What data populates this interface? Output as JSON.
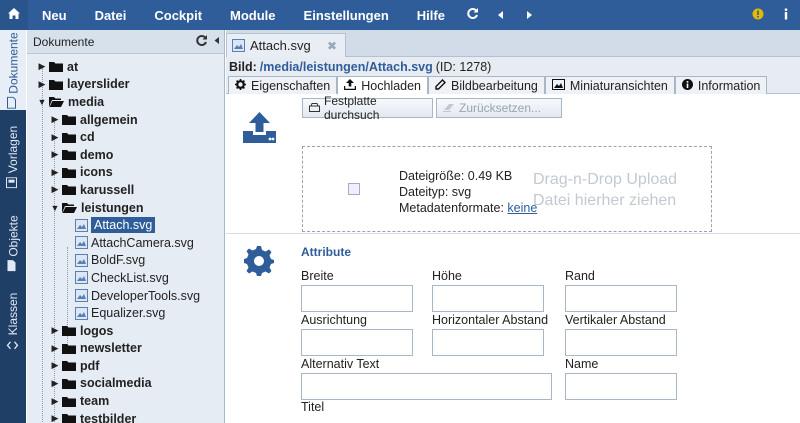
{
  "menu": {
    "items": [
      "Neu",
      "Datei",
      "Cockpit",
      "Module",
      "Einstellungen",
      "Hilfe"
    ]
  },
  "vtabs": [
    "Dokumente",
    "Vorlagen",
    "Objekte",
    "Klassen"
  ],
  "tree": {
    "title": "Dokumente",
    "nodes": [
      {
        "label": "at"
      },
      {
        "label": "layerslider"
      },
      {
        "label": "media"
      },
      {
        "label": "allgemein"
      },
      {
        "label": "cd"
      },
      {
        "label": "demo"
      },
      {
        "label": "icons"
      },
      {
        "label": "karussell"
      },
      {
        "label": "leistungen"
      },
      {
        "label": "Attach.svg"
      },
      {
        "label": "AttachCamera.svg"
      },
      {
        "label": "BoldF.svg"
      },
      {
        "label": "CheckList.svg"
      },
      {
        "label": "DeveloperTools.svg"
      },
      {
        "label": "Equalizer.svg"
      },
      {
        "label": "logos"
      },
      {
        "label": "newsletter"
      },
      {
        "label": "pdf"
      },
      {
        "label": "socialmedia"
      },
      {
        "label": "team"
      },
      {
        "label": "testbilder"
      }
    ]
  },
  "doc_tab": {
    "label": "Attach.svg"
  },
  "titlebar": {
    "prefix": "Bild:",
    "path": "/media/leistungen/Attach.svg",
    "id": "(ID: 1278)"
  },
  "subtabs": [
    "Eigenschaften",
    "Hochladen",
    "Bildbearbeitung",
    "Miniaturansichten",
    "Information"
  ],
  "upload": {
    "browse": "Festplatte durchsuch",
    "reset": "Zurücksetzen...",
    "size": "Dateigröße: 0.49 KB",
    "type": "Dateityp: svg",
    "meta_label": "Metadatenformate:",
    "meta_link": "keine",
    "dnd_line1": "Drag-n-Drop Upload",
    "dnd_line2": "Datei hierher ziehen"
  },
  "attributes": {
    "title": "Attribute",
    "breite": "Breite",
    "hoehe": "Höhe",
    "rand": "Rand",
    "ausrichtung": "Ausrichtung",
    "hor_abstand": "Horizontaler Abstand",
    "vert_abstand": "Vertikaler Abstand",
    "alt_text": "Alternativ Text",
    "name": "Name",
    "titel": "Titel"
  },
  "colors": {
    "accent": "#2f5d9a",
    "topbar": "#2f5d9a",
    "sidebar": "#1f3f66",
    "warning": "#e6b800"
  }
}
